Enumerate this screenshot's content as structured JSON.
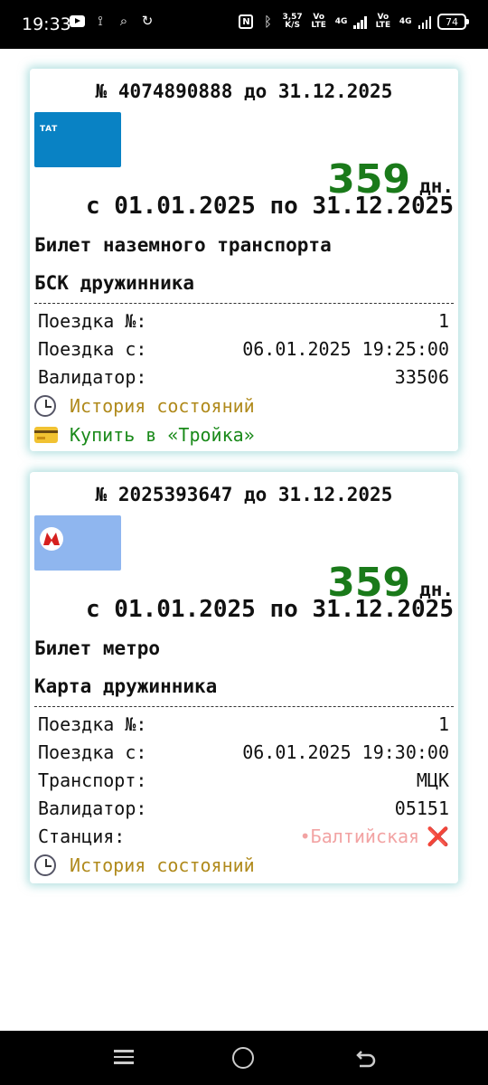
{
  "status_bar": {
    "time": "19:33",
    "net_speed": "3,57",
    "net_unit": "K/S",
    "lte1": "Vo LTE",
    "net1": "4G",
    "lte2": "Vo LTE",
    "net2": "4G",
    "battery": "74",
    "icons": [
      "youtube-icon",
      "mi-fit-icon",
      "search-icon",
      "sync-icon",
      "nfc-icon",
      "bluetooth-icon"
    ]
  },
  "cards": [
    {
      "title": "№ 4074890888 до 31.12.2025",
      "logo_text": "ТАТ",
      "logo_color": "#0982c4",
      "days": "359",
      "days_unit": "дн.",
      "period": "с 01.01.2025 по 31.12.2025",
      "ticket_type": "Билет наземного транспорта",
      "card_name": "БСК дружинника",
      "rows": [
        {
          "label": "Поездка №:",
          "value": "1"
        },
        {
          "label": "Поездка с:",
          "value": "06.01.2025 19:25:00"
        },
        {
          "label": "Валидатор:",
          "value": "33506"
        }
      ],
      "history_label": "История состояний",
      "buy_label": "Купить в «Тройка»"
    },
    {
      "title": "№ 2025393647 до 31.12.2025",
      "logo_color": "#8fb6ef",
      "days": "359",
      "days_unit": "дн.",
      "period": "с 01.01.2025 по 31.12.2025",
      "ticket_type": "Билет метро",
      "card_name": "Карта дружинника",
      "rows": [
        {
          "label": "Поездка №:",
          "value": "1"
        },
        {
          "label": "Поездка с:",
          "value": "06.01.2025 19:30:00"
        },
        {
          "label": "Транспорт:",
          "value": "МЦК"
        },
        {
          "label": "Валидатор:",
          "value": "05151"
        }
      ],
      "station_label": "Станция:",
      "station_value": "•Балтийская",
      "station_mark": "❌",
      "history_label": "История состояний"
    }
  ],
  "colors": {
    "days_green": "#1a7a1a",
    "history_gold": "#b08a1c",
    "buy_green": "#1a8a1a",
    "station_pink": "#f2a3a3",
    "card_glow": "#78c8c8"
  }
}
